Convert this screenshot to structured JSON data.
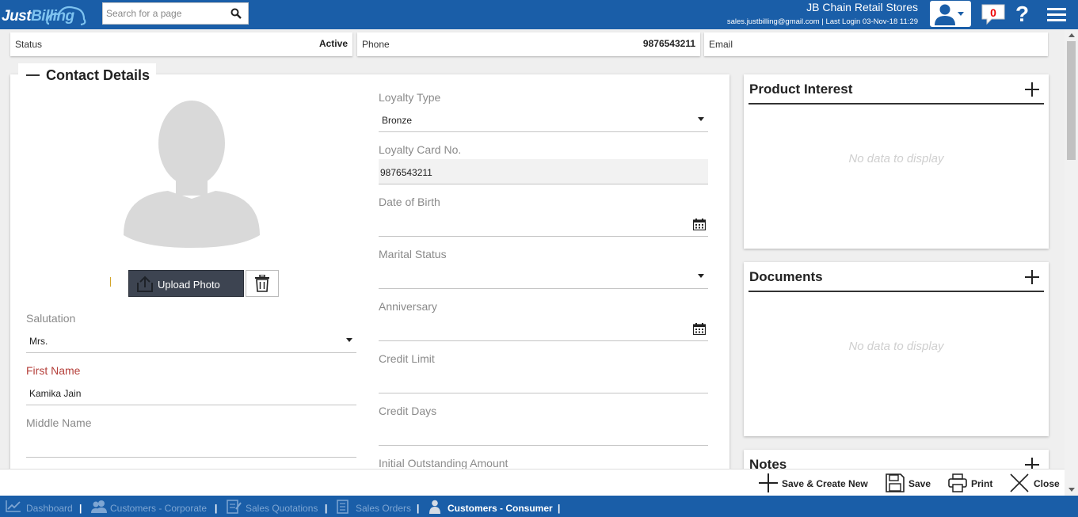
{
  "header": {
    "logo_text_1": "Just",
    "logo_text_2": "Billing",
    "search_placeholder": "Search for a page",
    "store_name": "JB Chain Retail Stores",
    "login_info": "sales.justbilling@gmail.com | Last Login 03-Nov-18 11:29",
    "notification_count": "0",
    "help_glyph": "?"
  },
  "summary": {
    "status_label": "Status",
    "status_value": "Active",
    "phone_label": "Phone",
    "phone_value": "9876543211",
    "email_label": "Email",
    "email_value": ""
  },
  "contact": {
    "title": "Contact Details",
    "upload_label": "Upload Photo",
    "salutation_label": "Salutation",
    "salutation_value": "Mrs.",
    "first_name_label": "First Name",
    "first_name_value": "Kamika Jain",
    "middle_name_label": "Middle Name",
    "middle_name_value": "",
    "loyalty_type_label": "Loyalty Type",
    "loyalty_type_value": "Bronze",
    "loyalty_card_label": "Loyalty Card No.",
    "loyalty_card_value": "9876543211",
    "dob_label": "Date of Birth",
    "dob_value": "",
    "marital_label": "Marital Status",
    "marital_value": "",
    "anniversary_label": "Anniversary",
    "anniversary_value": "",
    "credit_limit_label": "Credit Limit",
    "credit_limit_value": "",
    "credit_days_label": "Credit Days",
    "credit_days_value": "",
    "initial_outstanding_label": "Initial Outstanding Amount"
  },
  "panels": {
    "product_interest_title": "Product Interest",
    "product_interest_empty": "No data to display",
    "documents_title": "Documents",
    "documents_empty": "No data to display",
    "notes_title": "Notes"
  },
  "actions": {
    "save_create_new": "Save & Create New",
    "save": "Save",
    "print": "Print",
    "close": "Close"
  },
  "bottom_nav": {
    "items": [
      {
        "label": "Dashboard",
        "icon": "chart-icon"
      },
      {
        "label": "Customers - Corporate",
        "icon": "users-icon"
      },
      {
        "label": "Sales Quotations",
        "icon": "quotation-icon"
      },
      {
        "label": "Sales Orders",
        "icon": "order-icon"
      },
      {
        "label": "Customers - Consumer",
        "icon": "person-icon"
      }
    ],
    "separator": "|"
  },
  "colors": {
    "brand_blue": "#1a5ea8",
    "required_label": "#b5403b",
    "upload_button": "#3d4451"
  }
}
